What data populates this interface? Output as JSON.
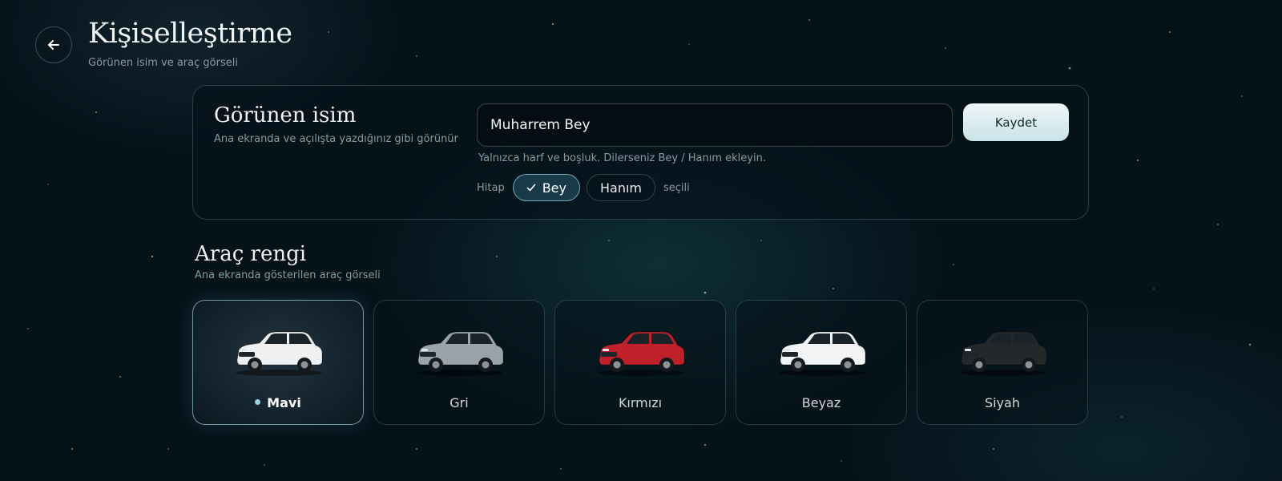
{
  "header": {
    "title": "Kişiselleştirme",
    "subtitle": "Görünen isim ve araç görseli"
  },
  "display_name": {
    "title": "Görünen isim",
    "subtitle": "Ana ekranda ve açılışta yazdığınız gibi görünür",
    "input_value": "Muharrem Bey",
    "save_label": "Kaydet",
    "hint": "Yalnızca harf ve boşluk. Dilerseniz Bey / Hanım ekleyin.",
    "hitap_label": "Hitap",
    "options": [
      "Bey",
      "Hanım"
    ],
    "selected_option": "Bey",
    "selected_word": "seçili"
  },
  "car_color": {
    "title": "Araç rengi",
    "subtitle": "Ana ekranda gösterilen araç görseli",
    "options": [
      {
        "label": "Mavi",
        "body": "#eef0f2",
        "selected": true
      },
      {
        "label": "Gri",
        "body": "#9aa3aa",
        "selected": false
      },
      {
        "label": "Kırmızı",
        "body": "#c0202a",
        "selected": false
      },
      {
        "label": "Beyaz",
        "body": "#f2f3f4",
        "selected": false
      },
      {
        "label": "Siyah",
        "body": "#25282b",
        "selected": false
      }
    ]
  },
  "colors": {
    "background": "#06121a",
    "accent": "#9fd0df",
    "save_button": "#dcedf1"
  },
  "icons": [
    "arrow-left-icon",
    "check-icon"
  ]
}
